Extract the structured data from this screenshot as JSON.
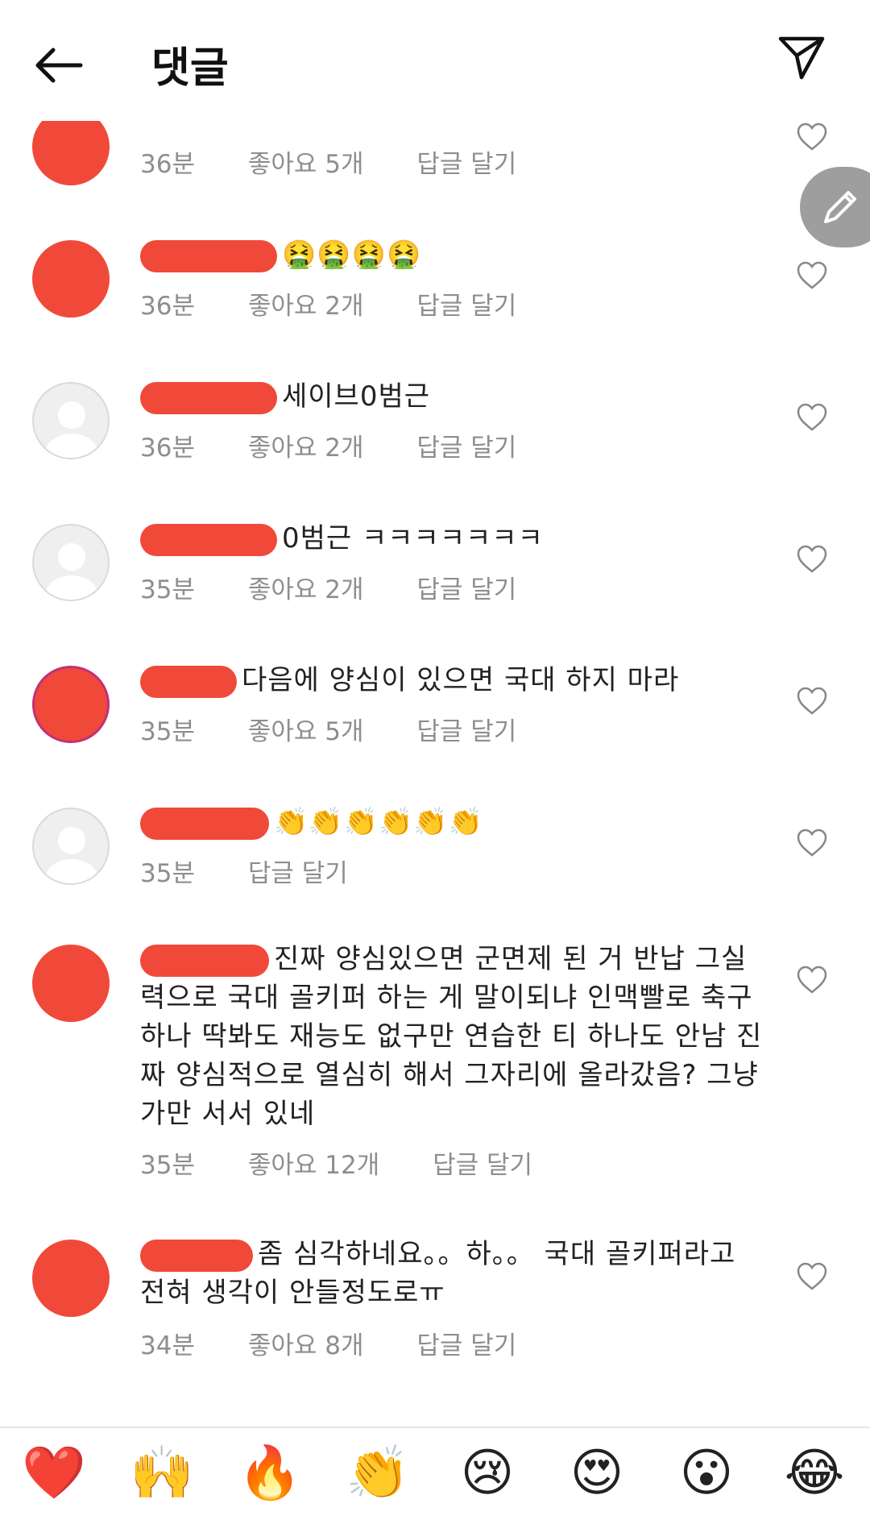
{
  "header": {
    "title": "댓글",
    "back_icon": "back-arrow-icon",
    "send_icon": "send-icon"
  },
  "comments": [
    {
      "text": "",
      "time": "36분",
      "likes": "좋아요 5개",
      "reply": "답글 달기"
    },
    {
      "text": "🤮🤮🤮🤮",
      "time": "36분",
      "likes": "좋아요 2개",
      "reply": "답글 달기"
    },
    {
      "text": "세이브0범근",
      "time": "36분",
      "likes": "좋아요 2개",
      "reply": "답글 달기"
    },
    {
      "text": "0범근 ㅋㅋㅋㅋㅋㅋㅋ",
      "time": "35분",
      "likes": "좋아요 2개",
      "reply": "답글 달기"
    },
    {
      "text": "다음에 양심이 있으면 국대 하지 마라",
      "time": "35분",
      "likes": "좋아요 5개",
      "reply": "답글 달기"
    },
    {
      "text": "👏👏👏👏👏👏",
      "time": "35분",
      "reply": "답글 달기"
    },
    {
      "text": "진짜 양심있으면 군면제 된 거 반납 그실력으로 국대 골키퍼 하는 게 말이되냐 인맥빨로 축구하나 딱봐도 재능도 없구만 연습한 티 하나도 안남 진짜 양심적으로 열심히 해서 그자리에 올라갔음? 그냥 가만 서서 있네",
      "time": "35분",
      "likes": "좋아요 12개",
      "reply": "답글 달기"
    },
    {
      "text": "좀 심각하네요。。하。。 국대 골키퍼라고 전혀 생각이 안들정도로ㅠ",
      "time": "34분",
      "likes": "좋아요 8개",
      "reply": "답글 달기"
    }
  ],
  "emoji_bar": [
    "❤️",
    "🙌",
    "🔥",
    "👏",
    "😢",
    "😍",
    "😮",
    "😂"
  ],
  "colors": {
    "redaction": "#f0493a",
    "meta_text": "#8e8e8e",
    "fab": "#9e9e9e"
  }
}
